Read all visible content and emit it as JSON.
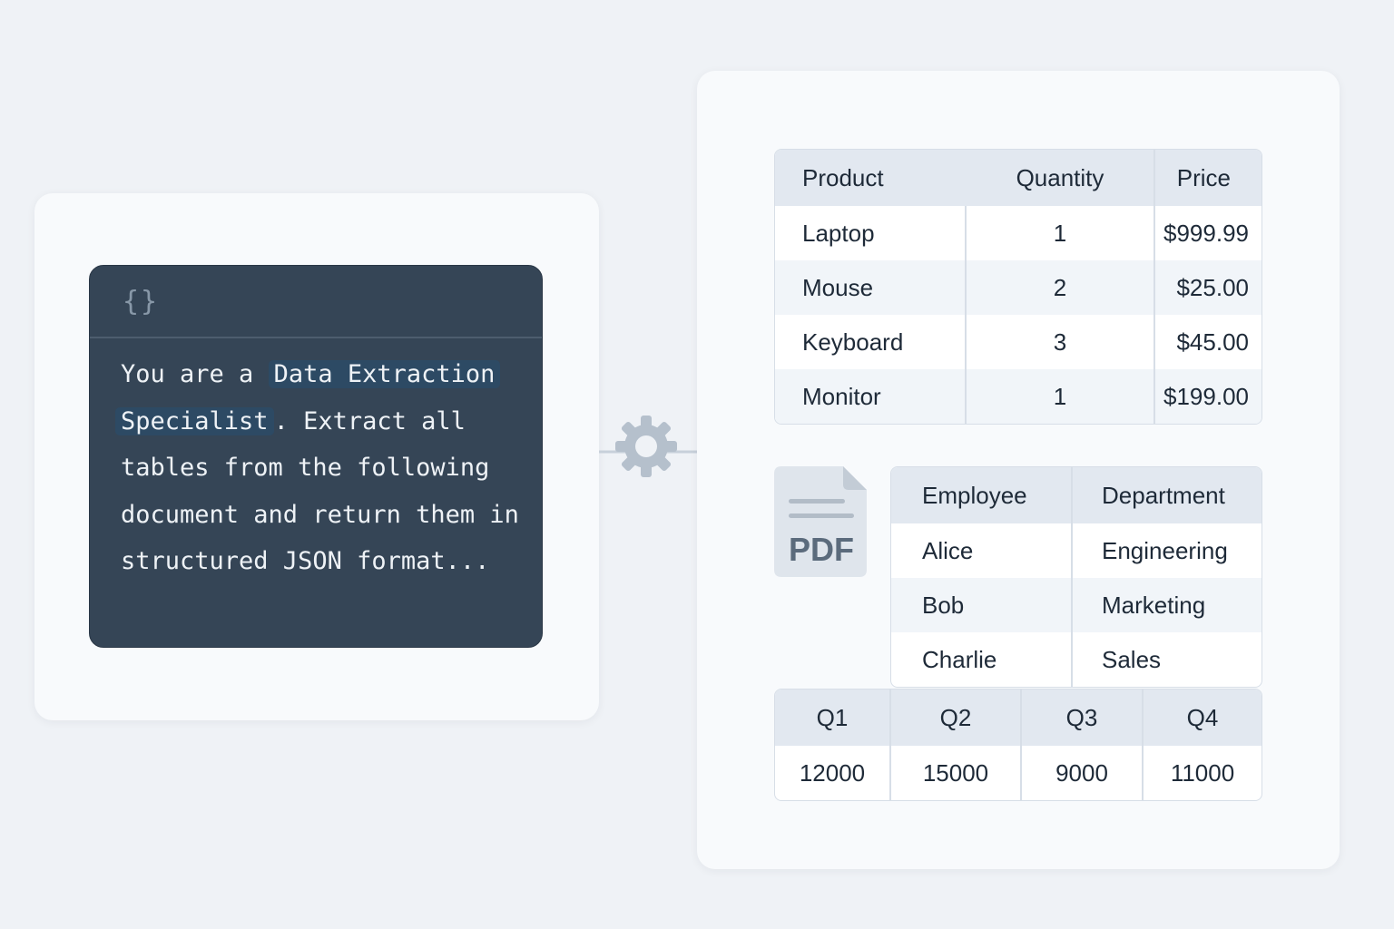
{
  "prompt": {
    "braces_glyph": "{}",
    "text_before": "You are a",
    "highlight_1": "Data Extraction",
    "highlight_2": "Specialist",
    "text_after": ". Extract all tables from the following document and return them in structured JSON format..."
  },
  "pdf": {
    "label": "PDF"
  },
  "tables": {
    "products": {
      "headers": [
        "Product",
        "Quantity",
        "Price"
      ],
      "rows": [
        [
          "Laptop",
          "1",
          "$999.99"
        ],
        [
          "Mouse",
          "2",
          "$25.00"
        ],
        [
          "Keyboard",
          "3",
          "$45.00"
        ],
        [
          "Monitor",
          "1",
          "$199.00"
        ]
      ]
    },
    "employees": {
      "headers": [
        "Employee",
        "Department"
      ],
      "rows": [
        [
          "Alice",
          "Engineering"
        ],
        [
          "Bob",
          "Marketing"
        ],
        [
          "Charlie",
          "Sales"
        ]
      ]
    },
    "quarters": {
      "headers": [
        "Q1",
        "Q2",
        "Q3",
        "Q4"
      ],
      "rows": [
        [
          "12000",
          "15000",
          "9000",
          "11000"
        ]
      ]
    }
  },
  "icons": [
    "code-braces-icon",
    "gear-icon",
    "arrow-right-icon",
    "pdf-file-icon"
  ],
  "colors": {
    "background": "#eff2f6",
    "code_bg": "#354556",
    "highlight": "#2d4a64",
    "header_fill": "#e2e8f0"
  }
}
